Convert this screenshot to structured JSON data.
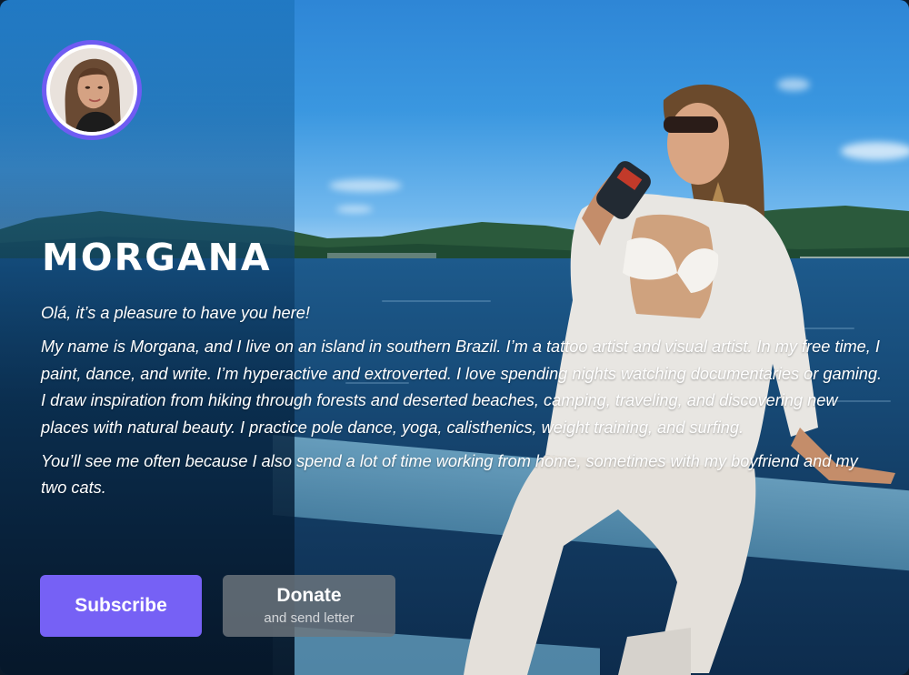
{
  "profile": {
    "name": "MORGANA",
    "avatar_alt": "profile photo",
    "bio": [
      "Olá, it’s a pleasure to have you here!",
      "My name is Morgana, and I live on an island in southern Brazil. I’m a tattoo artist and visual artist. In my free time, I paint, dance, and write. I’m hyperactive and extroverted. I love spending nights watching documentaries or gaming. I draw inspiration from hiking through forests and deserted beaches, camping, traveling, and discovering new places with natural beauty. I practice pole dance, yoga, calisthenics, weight training, and surfing.",
      "You’ll see me often because I also spend a lot of time working from home, sometimes with my boyfriend and my two cats."
    ]
  },
  "actions": {
    "subscribe_label": "Subscribe",
    "donate_label": "Donate",
    "donate_sublabel": "and send letter"
  },
  "colors": {
    "accent": "#7661f5",
    "avatar_ring": "#6f5cf2",
    "donate_bg": "#6e767e"
  }
}
